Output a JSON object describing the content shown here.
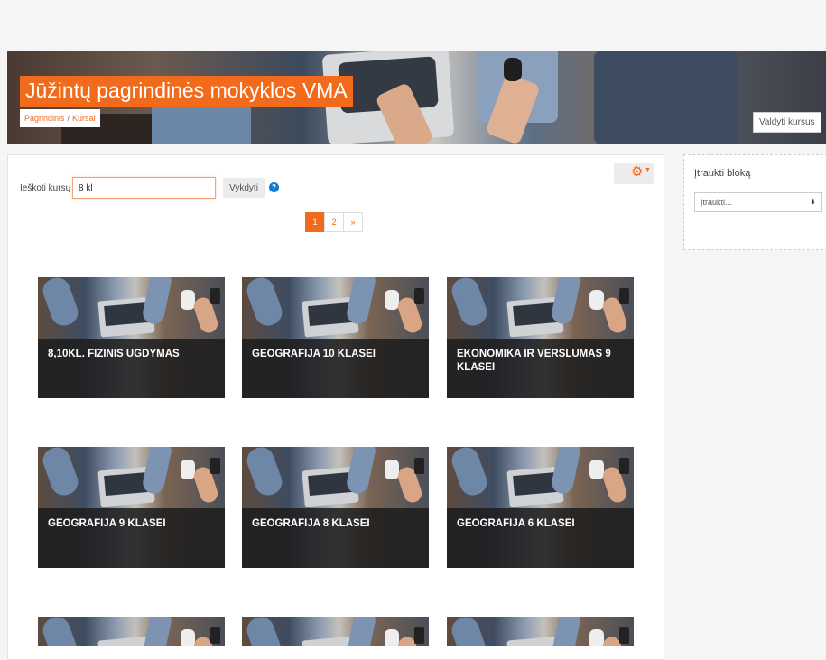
{
  "header": {
    "site_title": "Jūžintų pagrindinės mokyklos VMA",
    "breadcrumb": {
      "home": "Pagrindinis",
      "separator": "/",
      "current": "Kursai"
    },
    "manage_button": "Valdyti kursus"
  },
  "search": {
    "label": "Ieškoti kursų",
    "value": "8 kl",
    "button": "Vykdyti",
    "help": "?"
  },
  "settings": {
    "icon": "gear-icon",
    "glyph": "⚙",
    "caret": "▼"
  },
  "pagination": {
    "pages": [
      "1",
      "2"
    ],
    "next": "»",
    "active": "1"
  },
  "courses": [
    {
      "title": "8,10KL. FIZINIS UGDYMAS"
    },
    {
      "title": "GEOGRAFIJA 10 KLASEI"
    },
    {
      "title": "EKONOMIKA IR VERSLUMAS 9 KLASEI"
    },
    {
      "title": "GEOGRAFIJA 9 KLASEI"
    },
    {
      "title": "GEOGRAFIJA 8 KLASEI"
    },
    {
      "title": "GEOGRAFIJA 6 KLASEI"
    }
  ],
  "block": {
    "title": "Įtraukti bloką",
    "select_value": "Įtraukti...",
    "arrow": "⬍"
  },
  "colors": {
    "accent": "#f26a1b",
    "help": "#1177d1"
  }
}
